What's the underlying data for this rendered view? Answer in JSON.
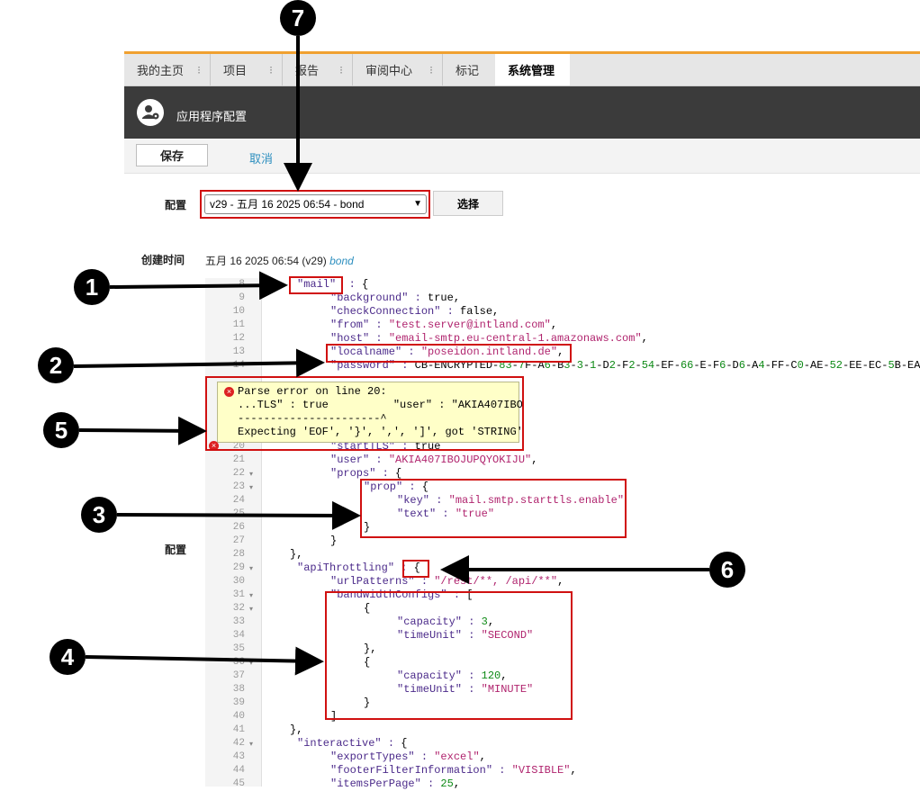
{
  "tabs": [
    {
      "label": "我的主页"
    },
    {
      "label": "项目"
    },
    {
      "label": "报告"
    },
    {
      "label": "审阅中心"
    },
    {
      "label": "标记"
    },
    {
      "label": "系统管理"
    }
  ],
  "header": {
    "title": "应用程序配置"
  },
  "toolbar": {
    "save_label": "保存",
    "cancel_label": "取消"
  },
  "config_row": {
    "label": "配置",
    "selected": "v29 - 五月 16 2025 06:54 - bond",
    "choose_label": "选择"
  },
  "created": {
    "label": "创建时间",
    "value": "五月 16 2025 06:54 (v29)",
    "user": "bond"
  },
  "config_editor_label": "配置",
  "error_tooltip": {
    "line1": "Parse error on line 20:",
    "line2": "...TLS\" : true          \"user\" : \"AKIA407IBO",
    "line3": "----------------------^",
    "line4": "Expecting 'EOF', '}', ',', ']', got 'STRING'"
  },
  "code_lines": [
    {
      "n": "8",
      "text": "\"mail\"  : {"
    },
    {
      "n": "9",
      "text": "  \"background\" : true,"
    },
    {
      "n": "10",
      "text": "  \"checkConnection\" : false,"
    },
    {
      "n": "11",
      "text": "  \"from\" : \"test.server@intland.com\","
    },
    {
      "n": "12",
      "text": "  \"host\" : \"email-smtp.eu-central-1.amazonaws.com\","
    },
    {
      "n": "13",
      "text": "  \"localname\" : \"poseidon.intland.de\","
    },
    {
      "n": "14",
      "text": "  \"password\" : \"CB-ENCRYPTED-83-7F-A6-B3-3-1-D2-F2-54-EF-66-E-F6-D6-A4-FF-C0-AE-52-EE-EC-5B-EA-A"
    },
    {
      "n": "20",
      "text": "  \"startTLS\" : true"
    },
    {
      "n": "21",
      "text": "  \"user\" : \"AKIA407IBOJUPQYOKIJU\","
    },
    {
      "n": "22",
      "text": "  \"props\" : {"
    },
    {
      "n": "23",
      "text": "    \"prop\" : {"
    },
    {
      "n": "24",
      "text": "      \"key\" : \"mail.smtp.starttls.enable\""
    },
    {
      "n": "25",
      "text": "      \"text\" : \"true\""
    },
    {
      "n": "26",
      "text": "    }"
    },
    {
      "n": "27",
      "text": "  }"
    },
    {
      "n": "28",
      "text": "},"
    },
    {
      "n": "29",
      "text": "\"apiThrottling\" : {"
    },
    {
      "n": "30",
      "text": "  \"urlPatterns\" : \"/rest/**, /api/**\","
    },
    {
      "n": "31",
      "text": "  \"bandwidthConfigs\" : ["
    },
    {
      "n": "32",
      "text": "    {"
    },
    {
      "n": "33",
      "text": "      \"capacity\" : 3,"
    },
    {
      "n": "34",
      "text": "      \"timeUnit\" : \"SECOND\""
    },
    {
      "n": "35",
      "text": "    },"
    },
    {
      "n": "36",
      "text": "    {"
    },
    {
      "n": "37",
      "text": "      \"capacity\" : 120,"
    },
    {
      "n": "38",
      "text": "      \"timeUnit\" : \"MINUTE\""
    },
    {
      "n": "39",
      "text": "    }"
    },
    {
      "n": "40",
      "text": "  ]"
    },
    {
      "n": "41",
      "text": "},"
    },
    {
      "n": "42",
      "text": "\"interactive\" : {"
    },
    {
      "n": "43",
      "text": "  \"exportTypes\" : \"excel\","
    },
    {
      "n": "44",
      "text": "  \"footerFilterInformation\" : \"VISIBLE\","
    },
    {
      "n": "45",
      "text": "  \"itemsPerPage\" : 25,"
    }
  ],
  "markers": [
    "1",
    "2",
    "3",
    "4",
    "5",
    "6",
    "7"
  ],
  "colors": {
    "accent": "#f0a030",
    "header_bg": "#3b3b3b",
    "annotation_red": "#d01010",
    "link": "#2d8fbf"
  }
}
